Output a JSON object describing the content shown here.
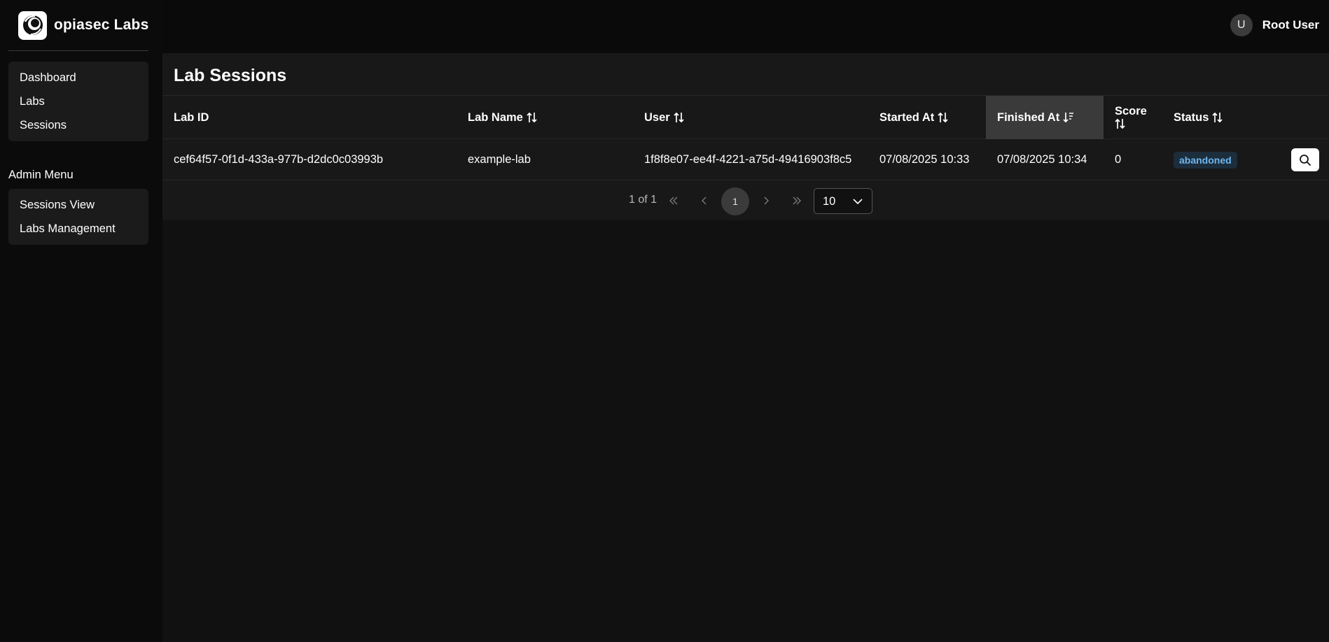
{
  "brand": {
    "name": "opiasec Labs"
  },
  "sidebar": {
    "items": [
      {
        "label": "Dashboard"
      },
      {
        "label": "Labs"
      },
      {
        "label": "Sessions"
      }
    ],
    "admin_title": "Admin Menu",
    "admin_items": [
      {
        "label": "Sessions View"
      },
      {
        "label": "Labs Management"
      }
    ]
  },
  "header": {
    "avatar_initial": "U",
    "user_name": "Root User"
  },
  "main": {
    "title": "Lab Sessions",
    "columns": [
      {
        "label": "Lab ID"
      },
      {
        "label": "Lab Name"
      },
      {
        "label": "User"
      },
      {
        "label": "Started At"
      },
      {
        "label": "Finished At"
      },
      {
        "label": "Score"
      },
      {
        "label": "Status"
      }
    ],
    "sorted_column": "Finished At",
    "rows": [
      {
        "lab_id": "cef64f57-0f1d-433a-977b-d2dc0c03993b",
        "lab_name": "example-lab",
        "user": "1f8f8e07-ee4f-4221-a75d-49416903f8c5",
        "started_at": "07/08/2025 10:33",
        "finished_at": "07/08/2025 10:34",
        "score": "0",
        "status": "abandoned"
      }
    ],
    "pagination": {
      "info": "1 of 1",
      "current_page": "1",
      "page_size": "10"
    }
  },
  "colors": {
    "background": "#111111",
    "panel": "#181818",
    "sidebar": "#0b0b0b",
    "badge_bg": "#1c2d3c",
    "badge_text": "#6eb6ee",
    "sorted_header": "#3a3a3a"
  },
  "icons": {
    "brand": "spiral-logo-icon",
    "sort": "sort-arrows-icon",
    "sort_desc": "sort-desc-icon",
    "view": "search-icon",
    "first": "chevrons-left-icon",
    "prev": "chevron-left-icon",
    "next": "chevron-right-icon",
    "last": "chevrons-right-icon",
    "dropdown": "chevron-down-icon"
  }
}
